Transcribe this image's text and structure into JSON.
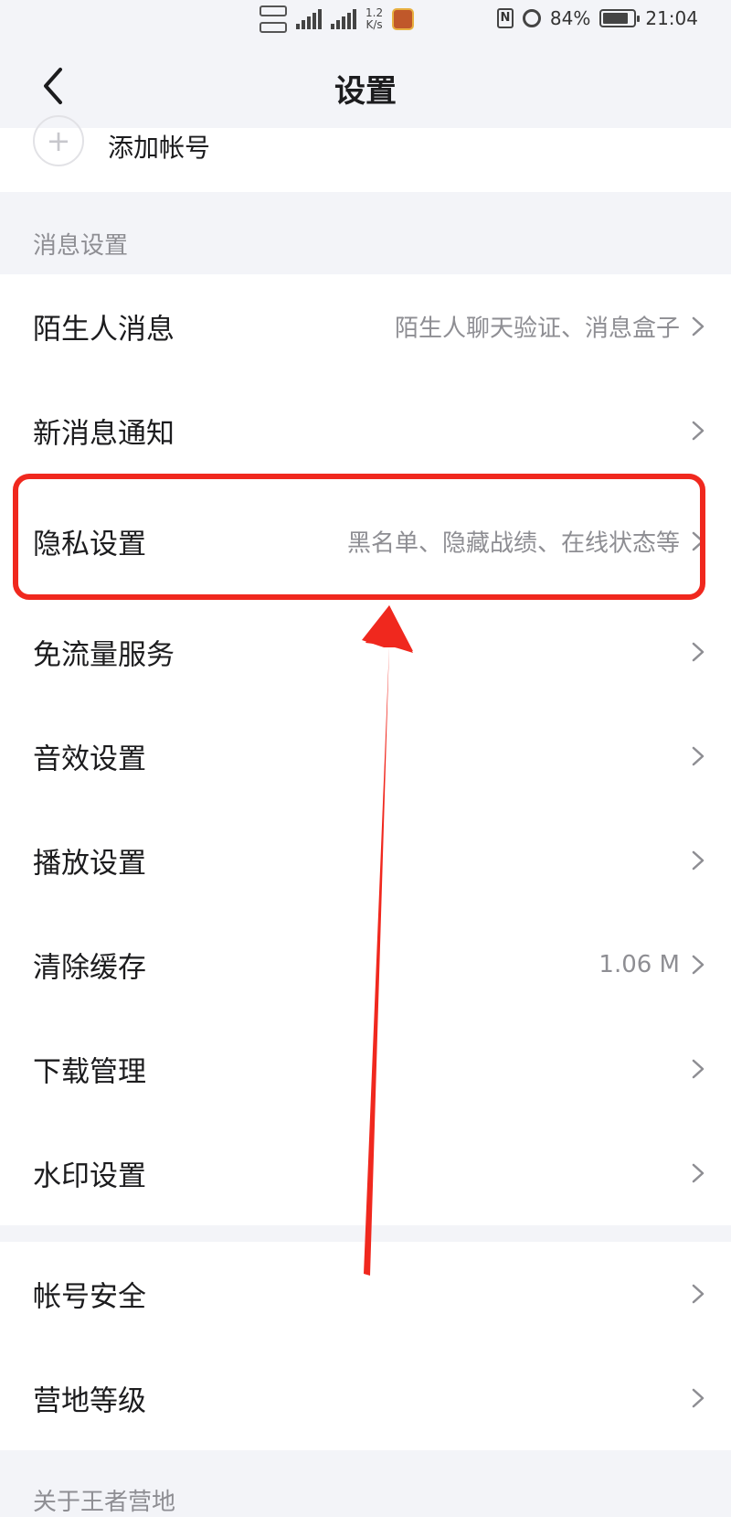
{
  "status_bar": {
    "net_speed_value": "1.2",
    "net_speed_unit": "K/s",
    "battery": "84%",
    "time": "21:04",
    "battery_level": 0.84
  },
  "header": {
    "title": "设置",
    "back_icon": "chevron-left-icon"
  },
  "add_account": {
    "label": "添加帐号",
    "icon": "plus-icon"
  },
  "message_section": {
    "title": "消息设置"
  },
  "group1": {
    "items": [
      {
        "label": "陌生人消息",
        "value": "陌生人聊天验证、消息盒子"
      },
      {
        "label": "新消息通知",
        "value": ""
      },
      {
        "label": "隐私设置",
        "value": "黑名单、隐藏战绩、在线状态等"
      },
      {
        "label": "免流量服务",
        "value": ""
      },
      {
        "label": "音效设置",
        "value": ""
      },
      {
        "label": "播放设置",
        "value": ""
      },
      {
        "label": "清除缓存",
        "value": "1.06 M"
      },
      {
        "label": "下载管理",
        "value": ""
      },
      {
        "label": "水印设置",
        "value": ""
      }
    ]
  },
  "group2": {
    "items": [
      {
        "label": "帐号安全",
        "value": ""
      },
      {
        "label": "营地等级",
        "value": ""
      }
    ]
  },
  "bottom_section": {
    "title": "关于王者营地"
  },
  "colors": {
    "background": "#f3f4f8",
    "card": "#ffffff",
    "annotation_red": "#f0281e",
    "secondary_text": "#8e8e93"
  }
}
